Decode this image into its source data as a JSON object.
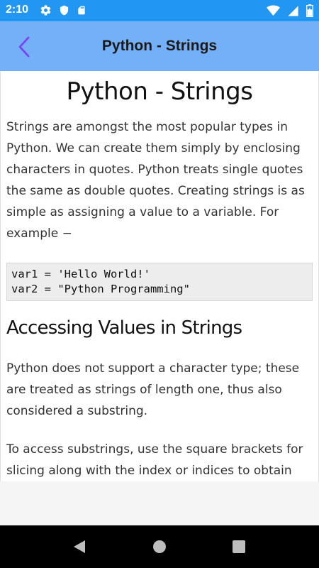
{
  "status_bar": {
    "time": "2:10",
    "left_icons": [
      "settings-icon",
      "shield-icon",
      "sd-card-icon"
    ],
    "right_icons": [
      "wifi-icon",
      "cell-signal-icon",
      "battery-icon"
    ]
  },
  "app_bar": {
    "title": "Python - Strings",
    "back_icon": "chevron-left-icon",
    "accent_color": "#74B0F7",
    "status_color": "#2196F3"
  },
  "content": {
    "title": "Python - Strings",
    "paragraph1": "Strings are amongst the most popular types in Python. We can create them simply by enclosing characters in quotes. Python treats single quotes the same as double quotes. Creating strings is as simple as assigning a value to a variable. For example −",
    "code": "var1 = 'Hello World!'\nvar2 = \"Python Programming\"",
    "section_heading": "Accessing Values in Strings",
    "paragraph2": "Python does not support a character type; these are treated as strings of length one, thus also considered a substring.",
    "paragraph3": "To access substrings, use the square brackets for slicing along with the index or indices to obtain your substring. For example −"
  },
  "nav_bar": {
    "icons": [
      "nav-back-icon",
      "nav-home-icon",
      "nav-recent-icon"
    ]
  }
}
